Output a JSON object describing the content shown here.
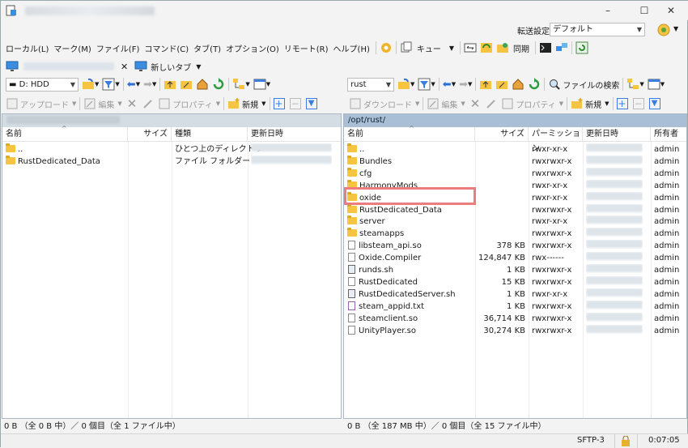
{
  "window": {
    "controls": {
      "minimize": "–",
      "maximize": "☐",
      "close": "✕"
    }
  },
  "transfer": {
    "label": "転送設定",
    "value": "デフォルト"
  },
  "menu": [
    "ローカル(L)",
    "マーク(M)",
    "ファイル(F)",
    "コマンド(C)",
    "タブ(T)",
    "オプション(O)",
    "リモート(R)",
    "ヘルプ(H)"
  ],
  "toolbar": {
    "queue": "キュー",
    "sync": "同期"
  },
  "tabs": {
    "new_tab": "新しいタブ"
  },
  "left": {
    "drive": "D: HDD",
    "upload": "アップロード",
    "edit": "編集",
    "properties": "プロパティ",
    "new": "新規",
    "columns": {
      "name": "名前",
      "size": "サイズ",
      "type": "種類",
      "modified": "更新日時"
    },
    "rows": [
      {
        "name": "..",
        "type": "ひとつ上のディレクトリ"
      },
      {
        "name": "RustDedicated_Data",
        "type": "ファイル フォルダー"
      }
    ],
    "status": "0 B （全 0 B 中）／ 0 個目（全 1 ファイル中）"
  },
  "right": {
    "drive": "rust",
    "find": "ファイルの検索",
    "download": "ダウンロード",
    "edit": "編集",
    "properties": "プロパティ",
    "new": "新規",
    "path": "/opt/rust/",
    "columns": {
      "name": "名前",
      "size": "サイズ",
      "perm": "パーミッション",
      "modified": "更新日時",
      "owner": "所有者"
    },
    "rows": [
      {
        "name": "..",
        "size": "",
        "perm": "rwxr-xr-x",
        "owner": "admin",
        "kind": "up"
      },
      {
        "name": "Bundles",
        "size": "",
        "perm": "rwxrwxr-x",
        "owner": "admin",
        "kind": "folder"
      },
      {
        "name": "cfg",
        "size": "",
        "perm": "rwxrwxr-x",
        "owner": "admin",
        "kind": "folder"
      },
      {
        "name": "HarmonyMods",
        "size": "",
        "perm": "rwxr-xr-x",
        "owner": "admin",
        "kind": "folder"
      },
      {
        "name": "oxide",
        "size": "",
        "perm": "rwxr-xr-x",
        "owner": "admin",
        "kind": "folder"
      },
      {
        "name": "RustDedicated_Data",
        "size": "",
        "perm": "rwxrwxr-x",
        "owner": "admin",
        "kind": "folder"
      },
      {
        "name": "server",
        "size": "",
        "perm": "rwxr-xr-x",
        "owner": "admin",
        "kind": "folder"
      },
      {
        "name": "steamapps",
        "size": "",
        "perm": "rwxrwxr-x",
        "owner": "admin",
        "kind": "folder"
      },
      {
        "name": "libsteam_api.so",
        "size": "378 KB",
        "perm": "rwxrwxr-x",
        "owner": "admin",
        "kind": "file"
      },
      {
        "name": "Oxide.Compiler",
        "size": "124,847 KB",
        "perm": "rwx------",
        "owner": "admin",
        "kind": "file"
      },
      {
        "name": "runds.sh",
        "size": "1 KB",
        "perm": "rwxrwxr-x",
        "owner": "admin",
        "kind": "script"
      },
      {
        "name": "RustDedicated",
        "size": "15 KB",
        "perm": "rwxrwxr-x",
        "owner": "admin",
        "kind": "file"
      },
      {
        "name": "RustDedicatedServer.sh",
        "size": "1 KB",
        "perm": "rwxr-xr-x",
        "owner": "admin",
        "kind": "script"
      },
      {
        "name": "steam_appid.txt",
        "size": "1 KB",
        "perm": "rwxrwxr-x",
        "owner": "admin",
        "kind": "text"
      },
      {
        "name": "steamclient.so",
        "size": "36,714 KB",
        "perm": "rwxrwxr-x",
        "owner": "admin",
        "kind": "file"
      },
      {
        "name": "UnityPlayer.so",
        "size": "30,274 KB",
        "perm": "rwxrwxr-x",
        "owner": "admin",
        "kind": "file"
      }
    ],
    "status": "0 B （全 187 MB 中）／ 0 個目（全 15 ファイル中）"
  },
  "bottom": {
    "protocol": "SFTP-3",
    "time": "0:07:05"
  },
  "colors": {
    "pathbar": "#a9bfd6",
    "folder": "#f5c542",
    "highlight": "#ee7c7c"
  }
}
